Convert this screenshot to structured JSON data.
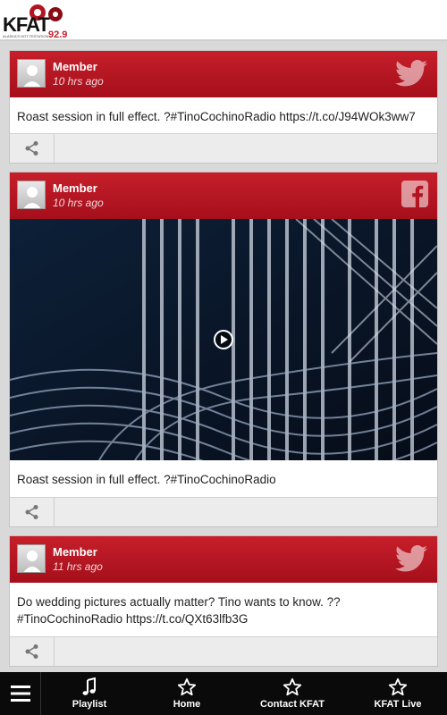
{
  "app": {
    "logo_text": "KFAT",
    "logo_frequency": "92.9",
    "logo_tagline": "ALASKA'S HOT TESTATION"
  },
  "posts": [
    {
      "author": "Member",
      "time": "10 hrs ago",
      "network": "twitter-icon",
      "text": "Roast session in full effect. ?#TinoCochinoRadio https://t.co/J94WOk3ww7"
    },
    {
      "author": "Member",
      "time": "10 hrs ago",
      "network": "facebook-icon",
      "text": "Roast session in full effect. ?#TinoCochinoRadio",
      "has_video": true
    },
    {
      "author": "Member",
      "time": "11 hrs ago",
      "network": "twitter-icon",
      "text": "Do wedding pictures actually matter? Tino wants to know. ?? #TinoCochinoRadio https://t.co/QXt63lfb3G"
    }
  ],
  "nav": {
    "items": [
      {
        "label": "Playlist",
        "icon": "music-note-icon"
      },
      {
        "label": "Home",
        "icon": "star-icon"
      },
      {
        "label": "Contact KFAT",
        "icon": "star-icon"
      },
      {
        "label": "KFAT Live",
        "icon": "star-icon"
      }
    ]
  },
  "colors": {
    "header_red": "#b3141f",
    "nav_bg": "#0a0a0a",
    "feed_bg": "#d9d9d9"
  }
}
